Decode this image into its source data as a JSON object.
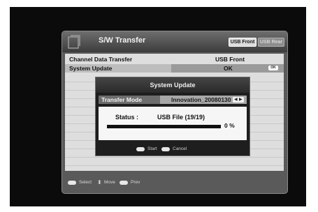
{
  "header": {
    "title": "S/W Transfer",
    "tabs": [
      "USB Front",
      "USB Rear"
    ],
    "icon": "folder-icon"
  },
  "rows": [
    {
      "label": "Channel Data Transfer",
      "value": "USB Front"
    },
    {
      "label": "System Update",
      "value": "OK",
      "button": "OK"
    }
  ],
  "dialog": {
    "title": "System Update",
    "mode_label": "Transfer Mode",
    "mode_value": "Innovation_20080130",
    "status_label": "Status :",
    "status_value": "USB File (19/19)",
    "progress_percent": 0,
    "percent_text": "0 %",
    "ok_key": "OK",
    "start": "Start",
    "cancel": "Cancel"
  },
  "footer": {
    "ok_key": "OK",
    "select": "Select",
    "move": "Move",
    "prev": "Prev"
  }
}
